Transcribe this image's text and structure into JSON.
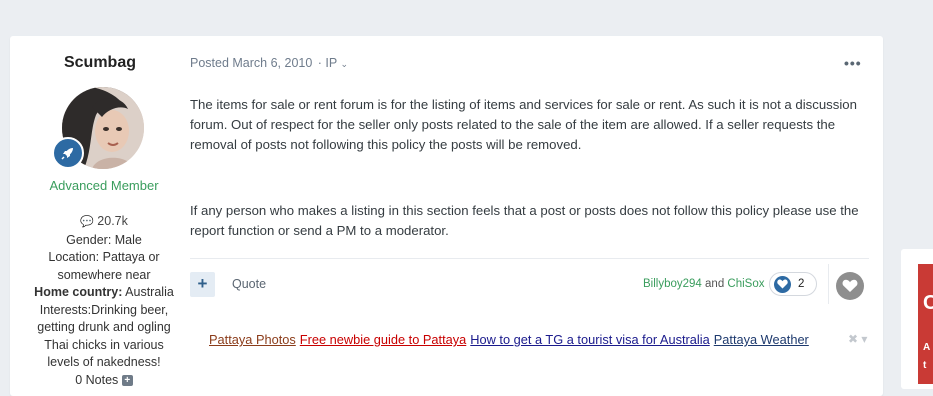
{
  "author": {
    "username": "Scumbag",
    "member_title": "Advanced Member",
    "posts_count": "20.7k",
    "gender": "Gender: Male",
    "location_line1": "Location: Pattaya or",
    "location_line2": "somewhere near",
    "home_country_label": "Home country:",
    "home_country_value": "Australia",
    "interests_line1": "Interests:Drinking beer,",
    "interests_line2": "getting drunk and ogling",
    "interests_line3": "Thai chicks in various",
    "interests_line4": "levels of nakedness!",
    "notes": "0 Notes"
  },
  "post": {
    "posted_label": "Posted March 6, 2010",
    "ip_label": "· IP",
    "more_menu": "•••",
    "paragraph1": "The items for sale or rent forum is for the listing of items and services for sale or rent. As such it is not a discussion forum. Out of respect for the seller only posts related to the sale of the item are allowed. If a seller requests the removal of posts not following this policy the posts will be removed.",
    "paragraph2": "If any person who makes a listing in this section feels that a post or posts does not follow this policy please use the report function or send a PM to a moderator."
  },
  "actions": {
    "plus": "+",
    "quote": "Quote",
    "reactor1": "Billyboy294",
    "reactor_and": "and",
    "reactor2": "ChiSox",
    "reaction_count": "2"
  },
  "signature": {
    "link1": "Pattaya Photos",
    "link2": "Free newbie guide to Pattaya",
    "link3": "How to get a TG a tourist visa for Australia",
    "link4": "Pattaya Weather",
    "close": "✖ ▾"
  },
  "sidebar": {
    "char1": "C",
    "char2": "A",
    "char3": "t"
  },
  "colors": {
    "accent": "#2d6aa3",
    "member_title": "#3a9d5d",
    "side_card": "#c93a35"
  }
}
